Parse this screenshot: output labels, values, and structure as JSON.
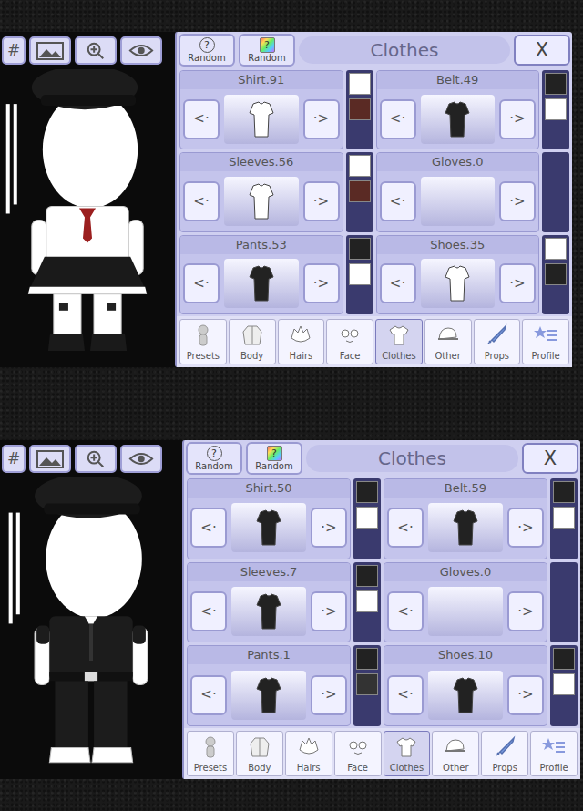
{
  "arrows": {
    "prev": "<·",
    "next": "·>"
  },
  "screens": [
    {
      "toolbar": {
        "hash": "#"
      },
      "character": {
        "kind": "skirt"
      },
      "panel": {
        "random_buttons": [
          {
            "badge": "?",
            "label": "Random",
            "kind": "plain"
          },
          {
            "badge": "?",
            "label": "Random",
            "kind": "rainbow"
          }
        ],
        "title": "Clothes",
        "close": "X",
        "items": [
          {
            "label": "Shirt.91",
            "swatches": [
              {
                "color": "#ffffff"
              },
              {
                "color": "#5a2a24"
              }
            ]
          },
          {
            "label": "Belt.49",
            "swatches": [
              {
                "color": "#222222"
              },
              {
                "color": "#ffffff"
              }
            ]
          },
          {
            "label": "Sleeves.56",
            "swatches": [
              {
                "color": "#ffffff"
              },
              {
                "color": "#5a2a24"
              }
            ]
          },
          {
            "label": "Gloves.0",
            "swatches": []
          },
          {
            "label": "Pants.53",
            "swatches": [
              {
                "color": "#222222"
              },
              {
                "color": "#ffffff"
              }
            ]
          },
          {
            "label": "Shoes.35",
            "swatches": [
              {
                "color": "#ffffff"
              },
              {
                "color": "#222222"
              }
            ]
          }
        ],
        "tabs": [
          {
            "label": "Presets",
            "selected": false
          },
          {
            "label": "Body",
            "selected": false
          },
          {
            "label": "Hairs",
            "selected": false
          },
          {
            "label": "Face",
            "selected": false
          },
          {
            "label": "Clothes",
            "selected": true
          },
          {
            "label": "Other",
            "selected": false
          },
          {
            "label": "Props",
            "selected": false
          },
          {
            "label": "Profile",
            "selected": false
          }
        ]
      }
    },
    {
      "toolbar": {
        "hash": "#"
      },
      "character": {
        "kind": "suit"
      },
      "panel": {
        "random_buttons": [
          {
            "badge": "?",
            "label": "Random",
            "kind": "plain"
          },
          {
            "badge": "?",
            "label": "Random",
            "kind": "rainbow"
          }
        ],
        "title": "Clothes",
        "close": "X",
        "items": [
          {
            "label": "Shirt.50",
            "swatches": [
              {
                "color": "#222222"
              },
              {
                "color": "#ffffff"
              }
            ]
          },
          {
            "label": "Belt.59",
            "swatches": [
              {
                "color": "#222222"
              },
              {
                "color": "#ffffff"
              }
            ]
          },
          {
            "label": "Sleeves.7",
            "swatches": [
              {
                "color": "#222222"
              },
              {
                "color": "#ffffff"
              }
            ]
          },
          {
            "label": "Gloves.0",
            "swatches": []
          },
          {
            "label": "Pants.1",
            "swatches": [
              {
                "color": "#222222"
              },
              {
                "color": "#333333"
              }
            ]
          },
          {
            "label": "Shoes.10",
            "swatches": [
              {
                "color": "#222222"
              },
              {
                "color": "#ffffff"
              }
            ]
          }
        ],
        "tabs": [
          {
            "label": "Presets",
            "selected": false
          },
          {
            "label": "Body",
            "selected": false
          },
          {
            "label": "Hairs",
            "selected": false
          },
          {
            "label": "Face",
            "selected": false
          },
          {
            "label": "Clothes",
            "selected": true
          },
          {
            "label": "Other",
            "selected": false
          },
          {
            "label": "Props",
            "selected": false
          },
          {
            "label": "Profile",
            "selected": false
          }
        ]
      }
    }
  ]
}
